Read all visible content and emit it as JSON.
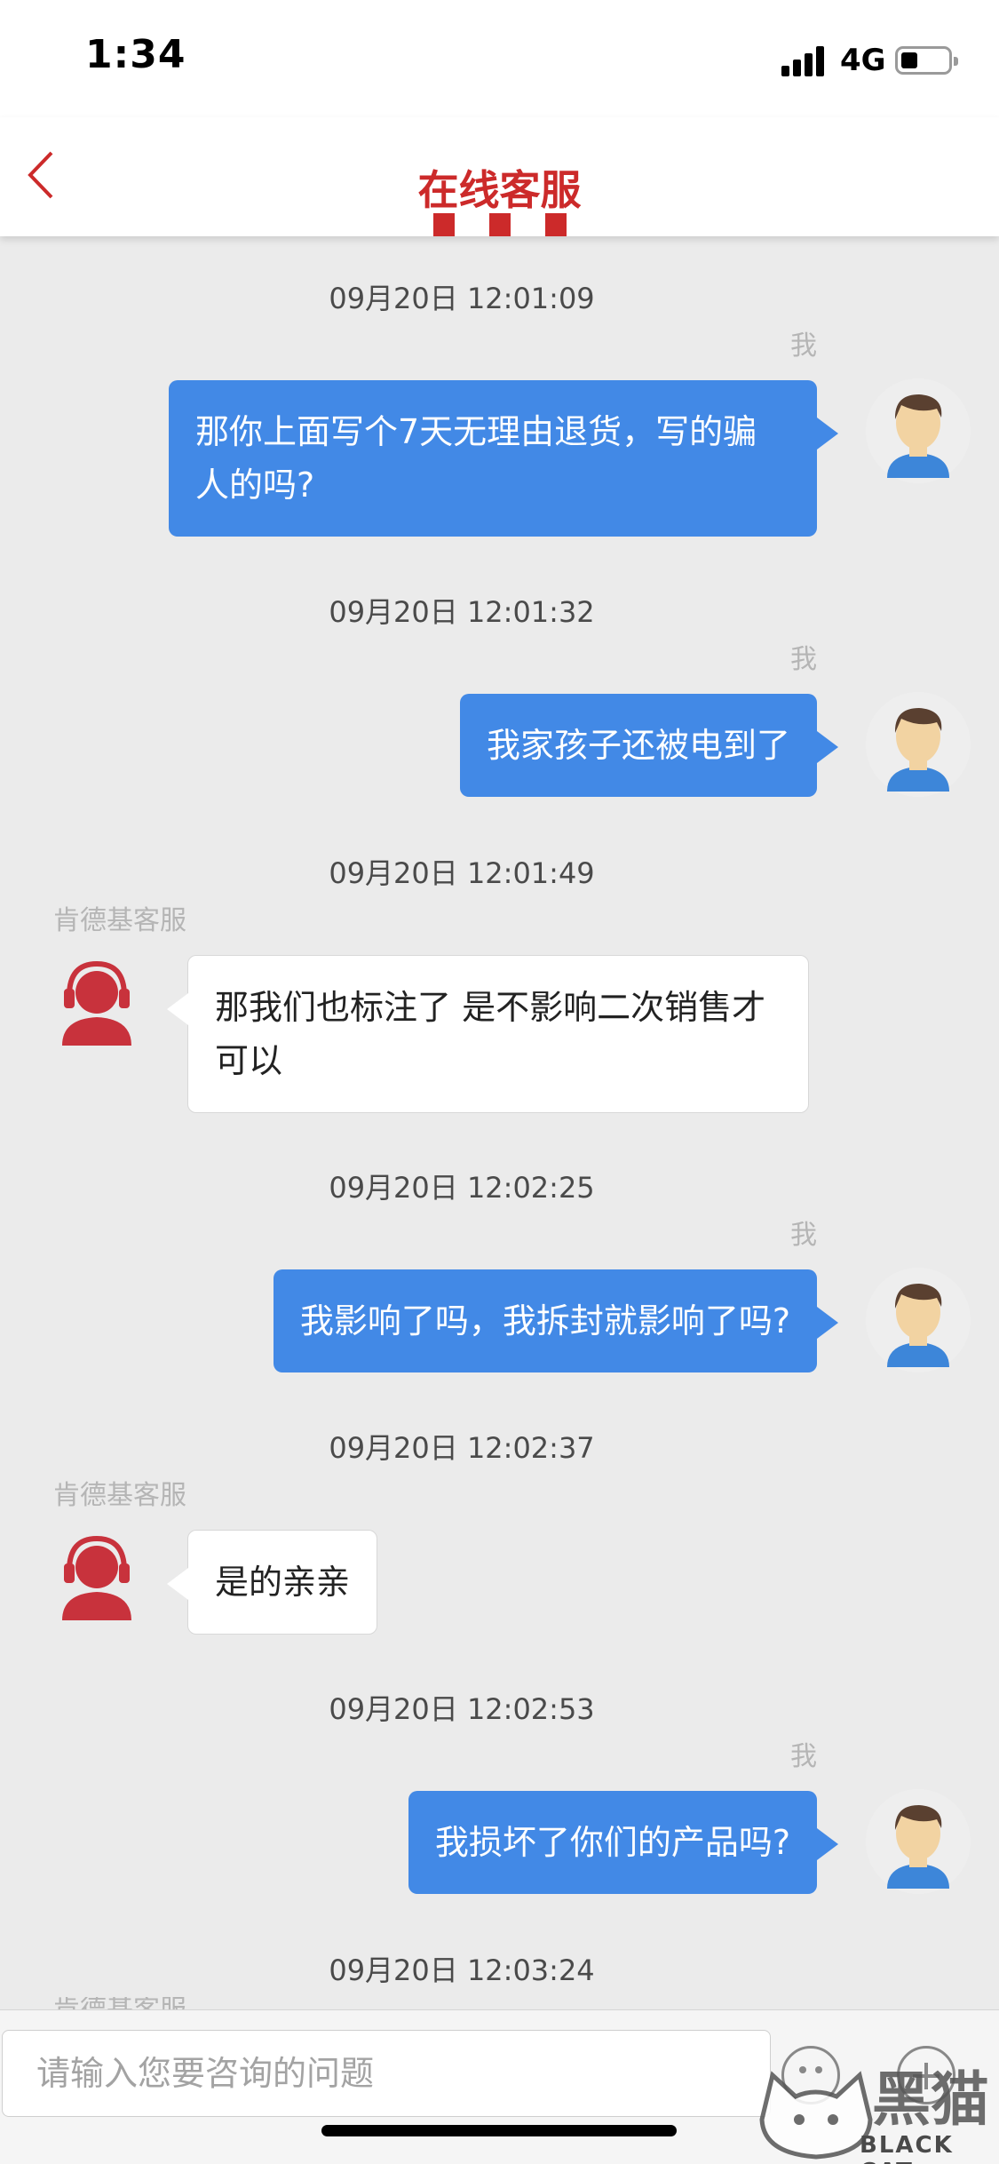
{
  "status_bar": {
    "time": "1:34",
    "network": "4G"
  },
  "nav": {
    "title": "在线客服"
  },
  "messages": [
    {
      "time": "09月20日 12:01:09",
      "sender": "我",
      "text": "那你上面写个7天无理由退货，写的骗人的吗?"
    },
    {
      "time": "09月20日 12:01:32",
      "sender": "我",
      "text": "我家孩子还被电到了"
    },
    {
      "time": "09月20日 12:01:49",
      "sender": "肯德基客服",
      "text": "那我们也标注了 是不影响二次销售才可以"
    },
    {
      "time": "09月20日 12:02:25",
      "sender": "我",
      "text": "我影响了吗，我拆封就影响了吗?"
    },
    {
      "time": "09月20日 12:02:37",
      "sender": "肯德基客服",
      "text": "是的亲亲"
    },
    {
      "time": "09月20日 12:02:53",
      "sender": "我",
      "text": "我损坏了你们的产品吗?"
    },
    {
      "time": "09月20日 12:03:24",
      "sender": "肯德基客服",
      "text": ""
    }
  ],
  "input": {
    "placeholder": "请输入您要咨询的问题",
    "value": ""
  },
  "watermark": {
    "text": "BLACK CAT",
    "logo_text": "黑猫"
  },
  "colors": {
    "accent": "#cc2a2a",
    "bubble_out": "#4289e6",
    "background": "#ebebeb"
  }
}
